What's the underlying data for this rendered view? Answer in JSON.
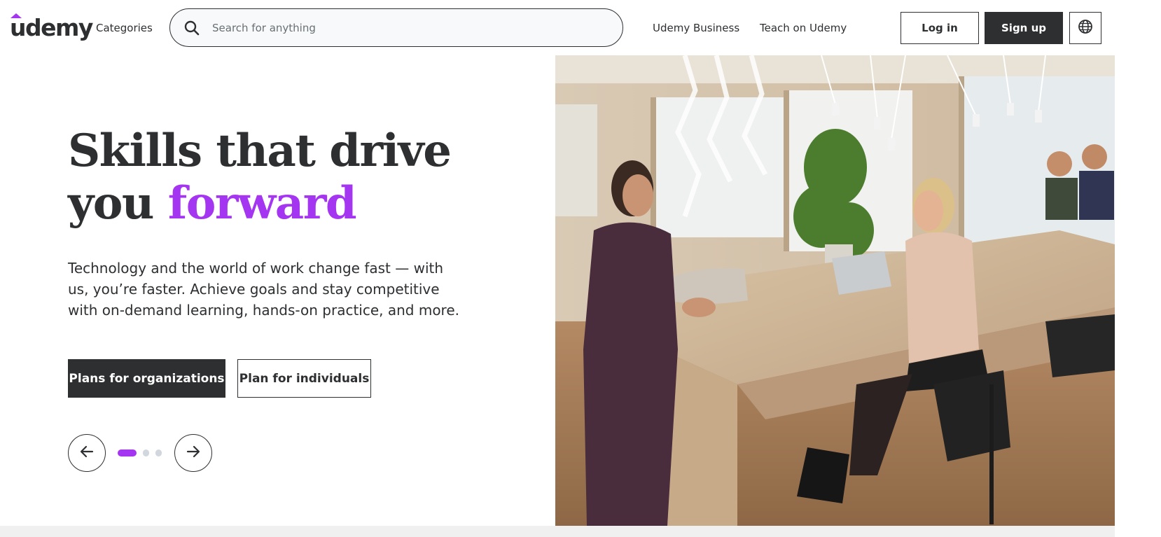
{
  "brand": {
    "logo_text": "udemy",
    "accent_color": "#a435f0",
    "dark_color": "#2d2f31"
  },
  "header": {
    "categories_label": "Categories",
    "search": {
      "placeholder": "Search for anything",
      "value": "",
      "icon": "search-icon"
    },
    "business_label": "Udemy Business",
    "teach_label": "Teach on Udemy",
    "login_label": "Log in",
    "signup_label": "Sign up",
    "language_icon": "globe-icon"
  },
  "hero": {
    "headline_part1": "Skills that drive",
    "headline_part2": "you ",
    "headline_accent": "forward",
    "subcopy": "Technology and the world of work change fast — with us, you’re faster. Achieve goals and stay competitive with on-demand learning, hands-on practice, and more.",
    "cta_primary": "Plans for organizations",
    "cta_secondary": "Plan for individuals",
    "carousel": {
      "prev_icon": "arrow-left-icon",
      "next_icon": "arrow-right-icon",
      "slides": 3,
      "active_index": 0
    },
    "image_subject": "office-meeting-photo"
  }
}
